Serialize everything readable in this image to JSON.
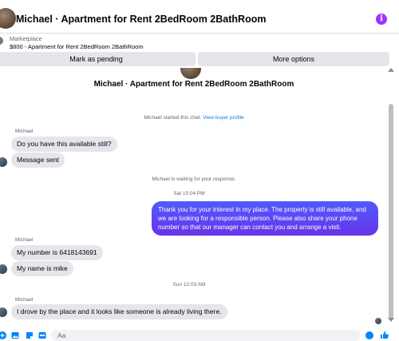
{
  "header": {
    "title": "Michael · Apartment for Rent 2BedRoom 2BathRoom",
    "info_glyph": "i"
  },
  "marketplace": {
    "label": "Marketplace",
    "listing": "$800 - Apartment for Rent 2BedRoom 2BathRoom"
  },
  "actions": {
    "pending_label": "Mark as pending",
    "more_label": "More options"
  },
  "chat": {
    "title": "Michael · Apartment for Rent 2BedRoom 2BathRoom",
    "started_text": "Michael started this chat.",
    "profile_link": "View buyer profile",
    "waiting_text": "Michael is waiting for your response.",
    "groups": [
      {
        "sender": "Michael",
        "messages": [
          "Do you have this available still?",
          "Message sent"
        ]
      },
      {
        "time": "Sat 10:04 PM"
      },
      {
        "outgoing": "Thank you for your interest in my place. The property is still available, and we are looking for a responsible person. Please also share your phone number so that our manager can contact you and arrange a visit."
      },
      {
        "sender": "Michael",
        "messages": [
          "My number is 6418143691",
          "My name is mike"
        ]
      },
      {
        "time": "Sun 12:03 AM"
      },
      {
        "sender": "Michael",
        "messages": [
          "I drove by the place and it looks like someone is already living there."
        ]
      }
    ]
  },
  "composer": {
    "placeholder": "Aa",
    "icons": [
      "plus-icon",
      "photo-icon",
      "sticker-icon",
      "gif-icon",
      "emoji-icon",
      "like-icon"
    ]
  },
  "colors": {
    "accent": "#0084ff",
    "outgoing_bubble": "#5a3cf0",
    "incoming_bubble": "#e4e6eb",
    "info": "#a033ff"
  }
}
